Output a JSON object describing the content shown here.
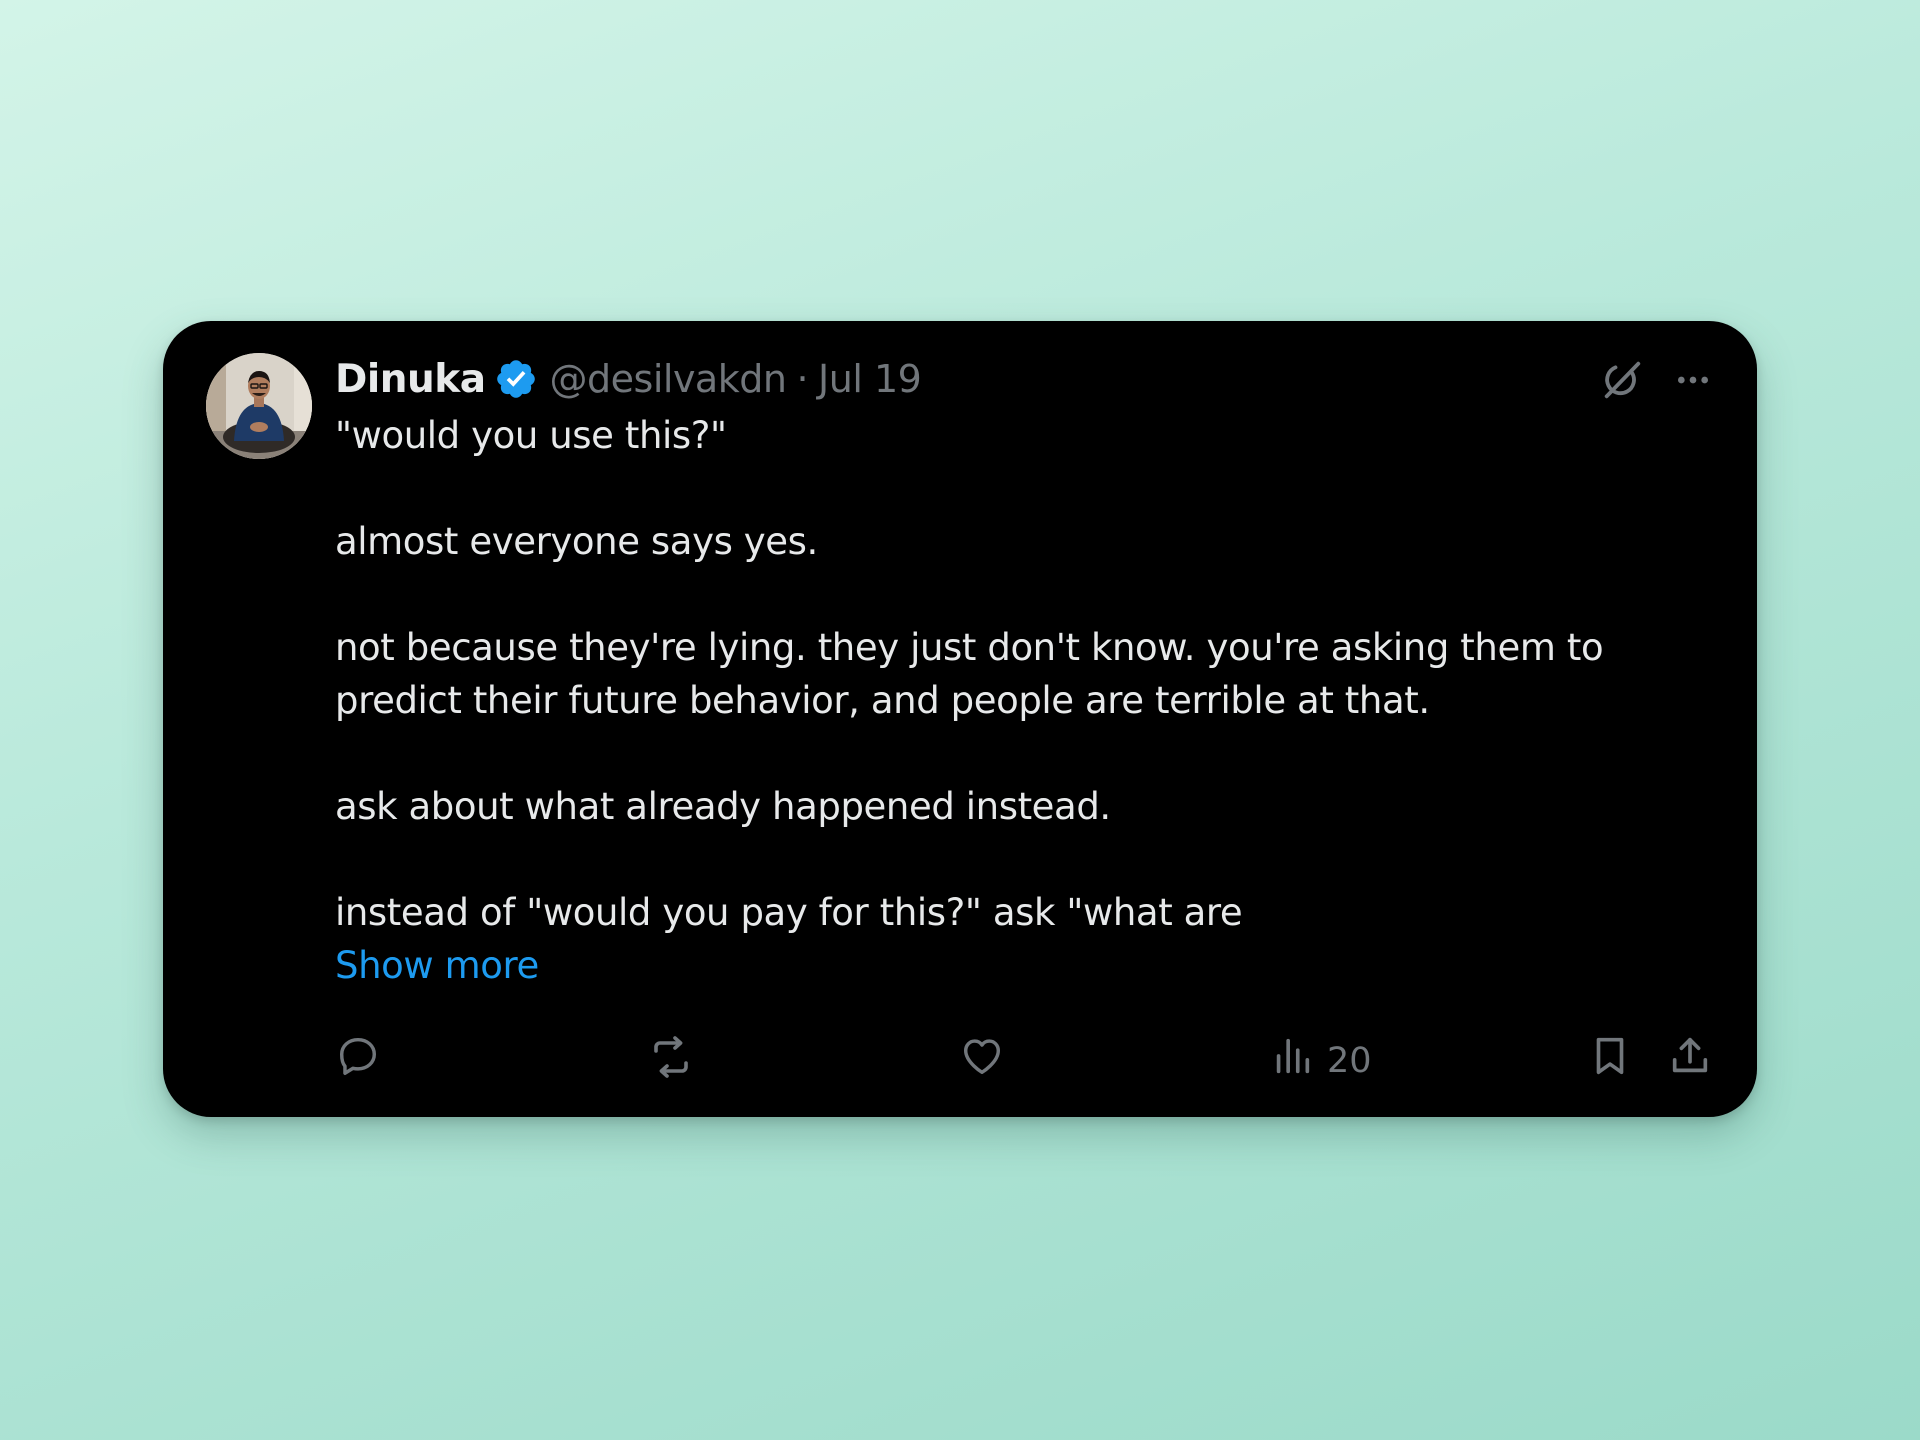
{
  "tweet": {
    "author_name": "Dinuka",
    "handle": "@desilvakdn",
    "separator": "·",
    "date": "Jul 19",
    "paragraphs": [
      "\"would you use this?\"",
      "almost everyone says yes.",
      "not because they're lying. they just don't know. you're asking them to predict their future behavior, and people are terrible at that.",
      "ask about what already happened instead.",
      "instead of \"would you pay for this?\" ask \"what are"
    ],
    "show_more_label": "Show more",
    "views_count": "20"
  },
  "colors": {
    "card_background": "#000000",
    "primary_text": "#e7e9ea",
    "secondary_text": "#71767b",
    "link": "#1d9bf0",
    "verified_badge": "#1d9bf0",
    "page_background_top": "#d3f4e8",
    "page_background_bottom": "#9bdac9"
  },
  "icons": {
    "verified": "verified-badge-icon",
    "grok": "grok-icon",
    "more": "more-options-icon",
    "reply": "reply-icon",
    "repost": "repost-icon",
    "like": "like-icon",
    "views": "views-icon",
    "bookmark": "bookmark-icon",
    "share": "share-icon"
  }
}
